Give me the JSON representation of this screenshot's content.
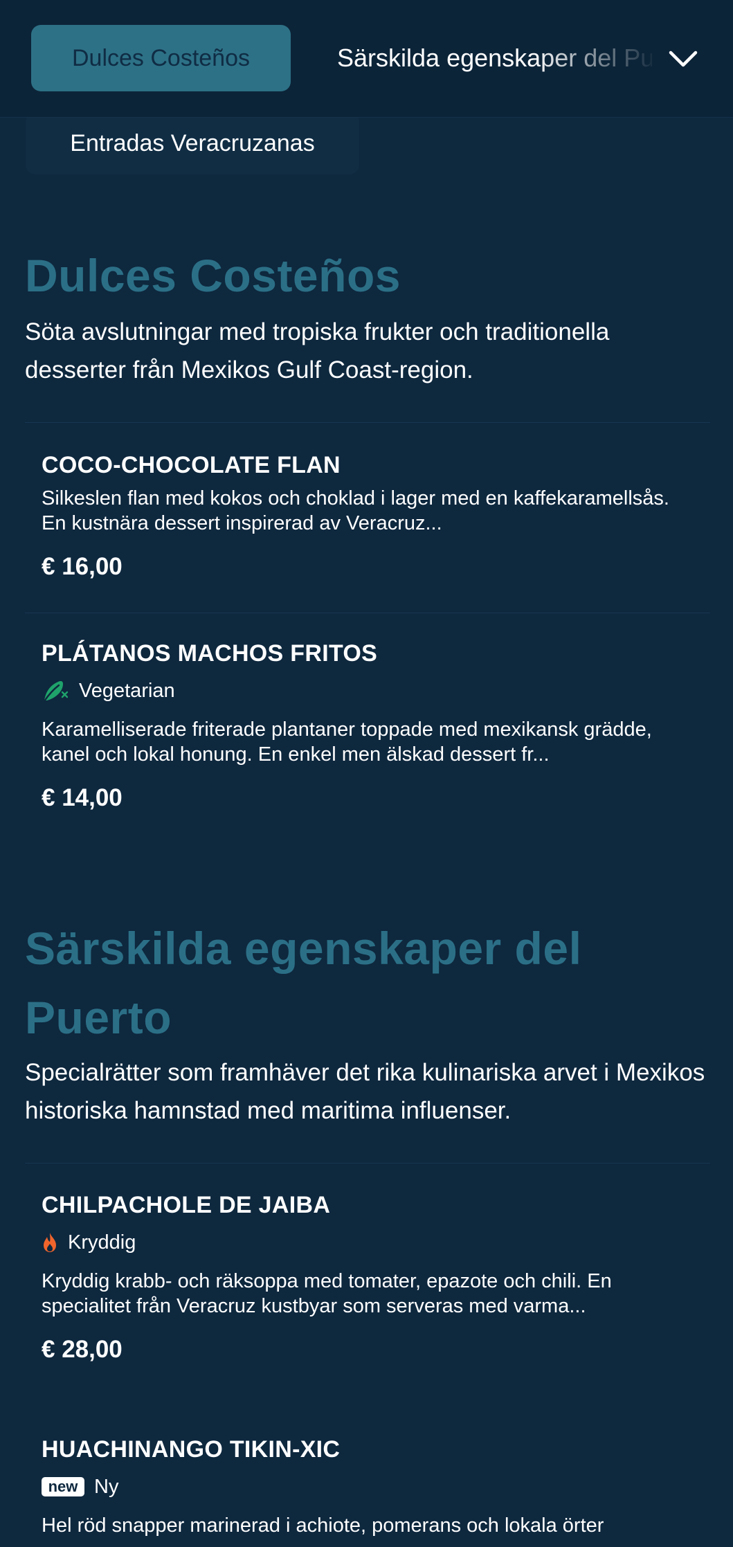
{
  "categories": {
    "active": "Dulces Costeños",
    "next": "Särskilda egenskaper del Puerto",
    "below": "Entradas Veracruzanas"
  },
  "icons": {
    "dropdown": "chevron-down-icon",
    "vegetarian": "leaf-icon",
    "spicy": "flame-icon",
    "new": "new-badge-icon"
  },
  "colors": {
    "background": "#0e283e",
    "accent": "#2d7186",
    "section_title": "#2b6f86",
    "vegetarian": "#1fa36b",
    "spicy": "#f0652c"
  },
  "sections": [
    {
      "title": "Dulces Costeños",
      "description": "Söta avslutningar med tropiska frukter och traditionella desserter från Mexikos Gulf Coast-region.",
      "items": [
        {
          "name": "COCO-CHOCOLATE FLAN",
          "description": "Silkeslen flan med kokos och choklad i lager med en kaffekaramellsås. En kustnära dessert inspirerad av Veracruz...",
          "price": "€ 16,00"
        },
        {
          "name": "PLÁTANOS MACHOS FRITOS",
          "tag": "Vegetarian",
          "description": "Karamelliserade friterade plantaner toppade med mexikansk grädde, kanel och lokal honung. En enkel men älskad dessert fr...",
          "price": "€ 14,00"
        }
      ]
    },
    {
      "title": "Särskilda egenskaper del Puerto",
      "description": "Specialrätter som framhäver det rika kulinariska arvet i Mexikos historiska hamnstad med maritima influenser.",
      "items": [
        {
          "name": "CHILPACHOLE DE JAIBA",
          "tag": "Kryddig",
          "description": "Kryddig krabb- och räksoppa med tomater, epazote och chili. En specialitet från Veracruz kustbyar som serveras med varma...",
          "price": "€ 28,00"
        },
        {
          "name": "HUACHINANGO TIKIN-XIC",
          "badge": "new",
          "tag": "Ny",
          "description": "Hel röd snapper marinerad i achiote, pomerans och lokala örter"
        }
      ]
    }
  ]
}
